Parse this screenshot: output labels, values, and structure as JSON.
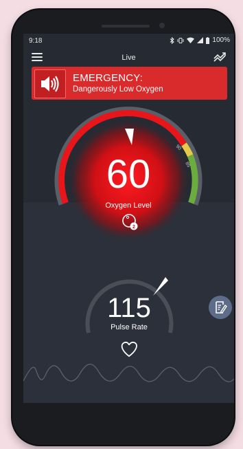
{
  "status_bar": {
    "time": "9:18",
    "battery": "100%",
    "icons": [
      "bluetooth-icon",
      "vibrate-icon",
      "wifi-icon",
      "signal-icon",
      "battery-icon"
    ]
  },
  "app_bar": {
    "title": "Live",
    "menu_icon": "menu-icon",
    "trend_icon": "trend-icon"
  },
  "alert": {
    "title": "EMERGENCY:",
    "message": "Dangerously Low Oxygen",
    "icon": "speaker-icon",
    "color": "#d92a2c"
  },
  "oxygen": {
    "value": "60",
    "label": "Oxygen Level",
    "tick_labels": [
      "90",
      "85"
    ],
    "icon": "o2-icon",
    "color": "#e8161b"
  },
  "pulse": {
    "value": "115",
    "label": "Pulse Rate",
    "icon": "heart-icon"
  },
  "note_button": {
    "icon": "note-edit-icon"
  },
  "colors": {
    "background": "#262a33",
    "critical": "#e8161b",
    "warning": "#e6c84a",
    "normal": "#6aad3e",
    "note_button": "#5d6c88"
  }
}
